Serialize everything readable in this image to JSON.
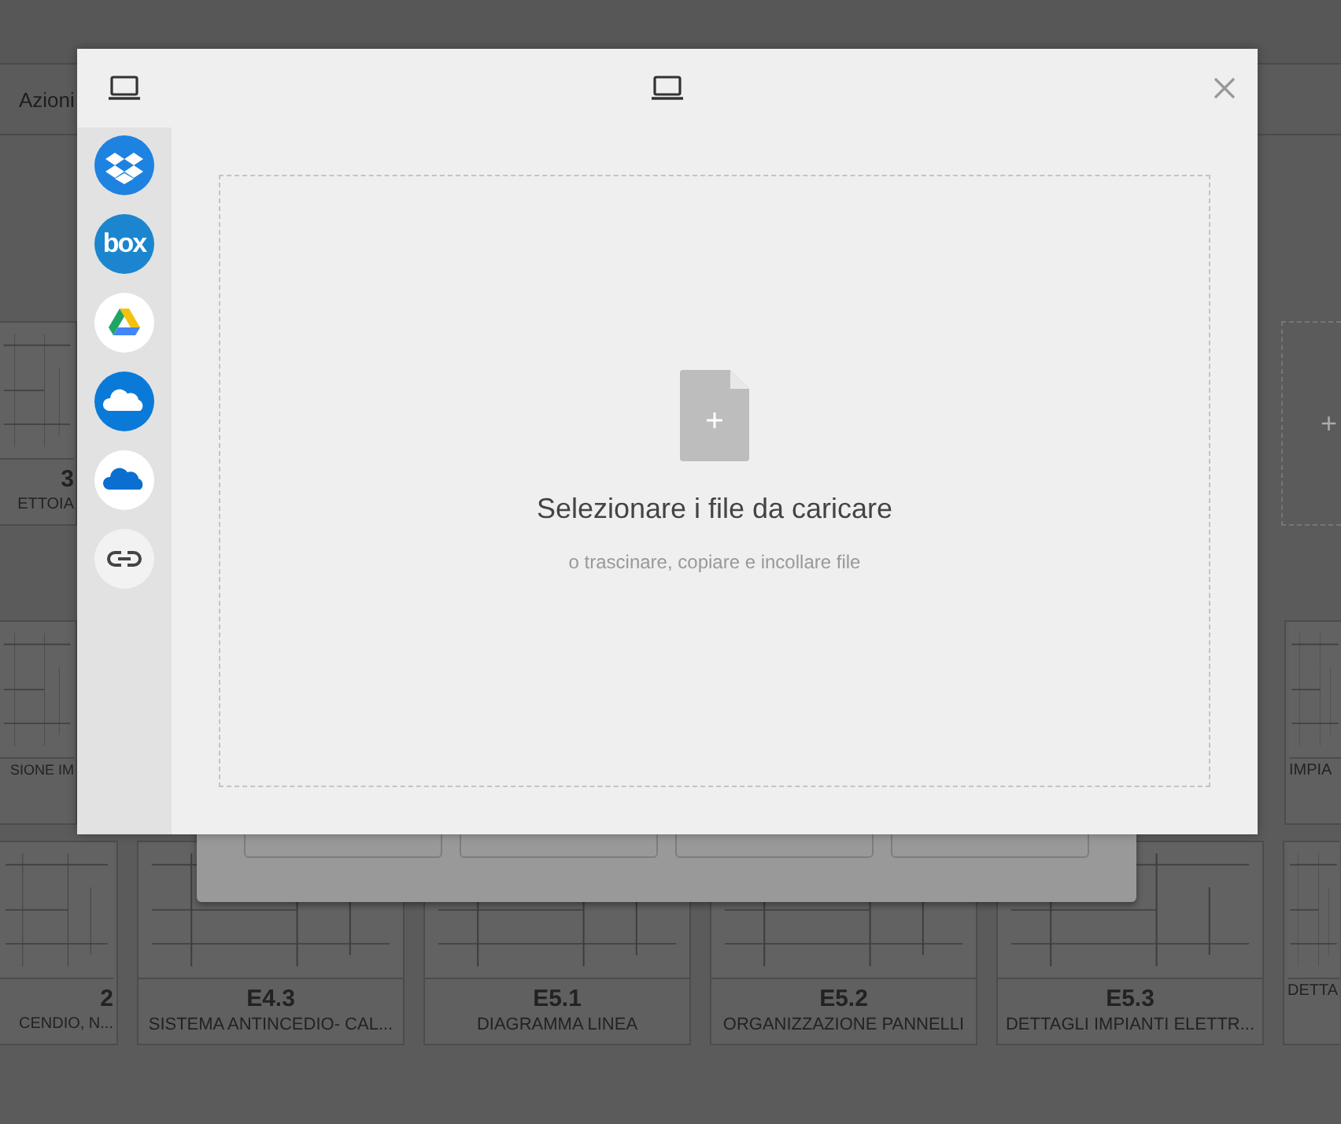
{
  "page": {
    "actions_label": "Azioni",
    "rows": [
      {
        "cards": [
          {
            "kind": "cut_left",
            "code": "3",
            "title": "ETTOIA"
          },
          {
            "kind": "add",
            "symbol": "+"
          }
        ]
      },
      {
        "cards": [
          {
            "kind": "cut_left",
            "title": "SIONE IM"
          },
          {
            "kind": "cut_right",
            "title": "IMPIA"
          }
        ]
      },
      {
        "cards": [
          {
            "kind": "cut_left",
            "code": "2",
            "title": "CENDIO, N..."
          },
          {
            "kind": "full",
            "code": "E4.3",
            "title": "SISTEMA ANTINCEDIO- CAL..."
          },
          {
            "kind": "full",
            "code": "E5.1",
            "title": "DIAGRAMMA LINEA"
          },
          {
            "kind": "full",
            "code": "E5.2",
            "title": "ORGANIZZAZIONE PANNELLI"
          },
          {
            "kind": "full",
            "code": "E5.3",
            "title": "DETTAGLI IMPIANTI ELETTR..."
          },
          {
            "kind": "cut_right",
            "title": "DETTA"
          }
        ]
      }
    ]
  },
  "upload_dialog": {
    "sources": [
      {
        "kind": "dropbox"
      },
      {
        "kind": "box",
        "label": "box"
      },
      {
        "kind": "drive"
      },
      {
        "kind": "onedrive"
      },
      {
        "kind": "onedrive_light"
      },
      {
        "kind": "link"
      }
    ],
    "drop_zone": {
      "title": "Selezionare i file da caricare",
      "subtitle": "o trascinare, copiare e incollare file"
    }
  }
}
